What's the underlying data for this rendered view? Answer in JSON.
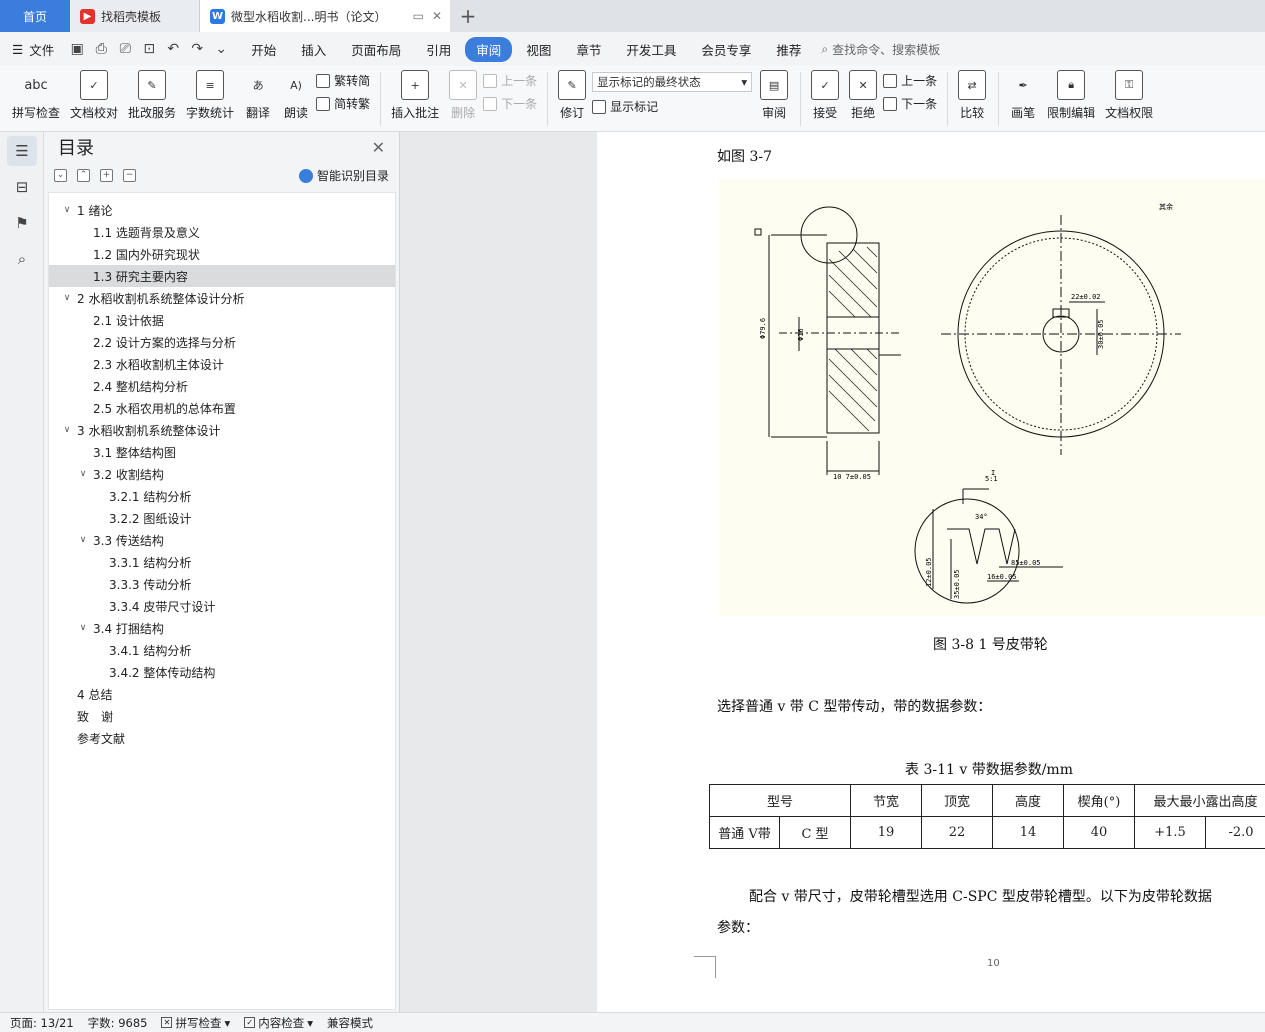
{
  "tabs": [
    {
      "label": "首页"
    },
    {
      "label": "找稻壳模板"
    },
    {
      "label": "微型水稻收割...明书（论文）"
    }
  ],
  "menubar": {
    "file_label": "文件",
    "items": [
      "开始",
      "插入",
      "页面布局",
      "引用",
      "审阅",
      "视图",
      "章节",
      "开发工具",
      "会员专享",
      "推荐"
    ],
    "active": "审阅",
    "search_placeholder": "查找命令、搜索模板"
  },
  "ribbon": {
    "spellcheck": "拼写检查",
    "spellcheck_icon": "abc",
    "doccheck": "文档校对",
    "review_service": "批改服务",
    "wordcount": "字数统计",
    "translate": "翻译",
    "read_aloud": "朗读",
    "trad_to_simp": "繁转简",
    "simp_to_trad": "简转繁",
    "insert_comment": "插入批注",
    "delete": "删除",
    "prev": "上一条",
    "next": "下一条",
    "revise": "修订",
    "markup_state": "显示标记的最终状态",
    "show_markup": "显示标记",
    "review": "审阅",
    "accept": "接受",
    "reject": "拒绝",
    "prev2": "上一条",
    "next2": "下一条",
    "compare": "比较",
    "pen": "画笔",
    "restrict_edit": "限制编辑",
    "doc_permission": "文档权限"
  },
  "toc": {
    "title": "目录",
    "smart_label": "智能识别目录",
    "items": [
      {
        "label": "1 绪论",
        "level": 1,
        "chev": "∨"
      },
      {
        "label": "1.1 选题背景及意义",
        "level": 2,
        "chev": ""
      },
      {
        "label": "1.2 国内外研究现状",
        "level": 2,
        "chev": ""
      },
      {
        "label": "1.3 研究主要内容",
        "level": 2,
        "chev": "",
        "selected": true
      },
      {
        "label": "2 水稻收割机系统整体设计分析",
        "level": 1,
        "chev": "∨"
      },
      {
        "label": "2.1 设计依据",
        "level": 2,
        "chev": ""
      },
      {
        "label": "2.2  设计方案的选择与分析",
        "level": 2,
        "chev": ""
      },
      {
        "label": "2.3 水稻收割机主体设计",
        "level": 2,
        "chev": ""
      },
      {
        "label": "2.4 整机结构分析",
        "level": 2,
        "chev": ""
      },
      {
        "label": "2.5 水稻农用机的总体布置",
        "level": 2,
        "chev": ""
      },
      {
        "label": "3 水稻收割机系统整体设计",
        "level": 1,
        "chev": "∨"
      },
      {
        "label": "3.1 整体结构图",
        "level": 2,
        "chev": ""
      },
      {
        "label": "3.2 收割结构",
        "level": 2,
        "chev": "∨"
      },
      {
        "label": "3.2.1 结构分析",
        "level": 3,
        "chev": ""
      },
      {
        "label": "3.2.2 图纸设计",
        "level": 3,
        "chev": ""
      },
      {
        "label": "3.3 传送结构",
        "level": 2,
        "chev": "∨"
      },
      {
        "label": "3.3.1 结构分析",
        "level": 3,
        "chev": ""
      },
      {
        "label": "3.3.3 传动分析",
        "level": 3,
        "chev": ""
      },
      {
        "label": "3.3.4 皮带尺寸设计",
        "level": 3,
        "chev": ""
      },
      {
        "label": "3.4 打捆结构",
        "level": 2,
        "chev": "∨"
      },
      {
        "label": "3.4.1 结构分析",
        "level": 3,
        "chev": ""
      },
      {
        "label": "3.4.2 整体传动结构",
        "level": 3,
        "chev": ""
      },
      {
        "label": "4 总结",
        "level": 1,
        "chev": ""
      },
      {
        "label": "致　谢",
        "level": 1,
        "chev": ""
      },
      {
        "label": "参考文献",
        "level": 1,
        "chev": ""
      }
    ]
  },
  "doc": {
    "fig_ref": "如图 3-7",
    "fig_caption": "图 3-8 1 号皮带轮",
    "para1": "选择普通 v 带 C 型带传动，带的数据参数：",
    "table_caption": "表 3-11 v 带数据参数/mm",
    "table_header": [
      "型号",
      "节宽",
      "顶宽",
      "高度",
      "楔角(°)",
      "最大最小露出高度"
    ],
    "table_row": [
      "普通 V带",
      "C 型",
      "19",
      "22",
      "14",
      "40",
      "+1.5",
      "-2.0"
    ],
    "para2": "配合 v 带尺寸，皮带轮槽型选用 C-SPC 型皮带轮槽型。以下为皮带轮数据",
    "para2b": "参数：",
    "page_number": "10",
    "drawing": {
      "dim_diameter": "Φ79.6",
      "dim_bore": "Φ16",
      "dim_width": "10 7±0.05",
      "dim_key": "22±0.02",
      "dim_keyh": "30±0.05",
      "scale_label": "5:1",
      "detail_label": "I",
      "angle": "34°",
      "dim_d1": "85±0.05",
      "dim_d2": "16±0.05",
      "dim_d3": "12±0.05",
      "dim_d4": "35±0.05",
      "corner_note": "其余"
    }
  },
  "status": {
    "page": "页面: 13/21",
    "words": "字数: 9685",
    "spell": "拼写检查",
    "content": "内容检查",
    "compat": "兼容模式"
  }
}
